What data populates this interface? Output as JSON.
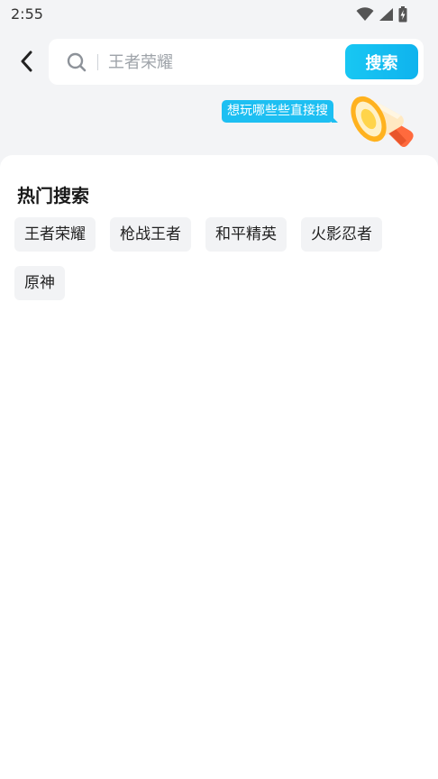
{
  "status_bar": {
    "time": "2:55",
    "icons": [
      "wifi-icon",
      "signal-icon",
      "battery-charging-icon"
    ]
  },
  "search": {
    "placeholder": "王者荣耀",
    "value": "",
    "button_label": "搜索"
  },
  "tip": {
    "text": "想玩哪些些直接搜"
  },
  "hot": {
    "title": "热门搜索",
    "tags": [
      "王者荣耀",
      "枪战王者",
      "和平精英",
      "火影忍者",
      "原神"
    ]
  },
  "colors": {
    "accent": "#1dbff2",
    "background": "#f3f4f6",
    "tag_bg": "#f2f3f5"
  }
}
